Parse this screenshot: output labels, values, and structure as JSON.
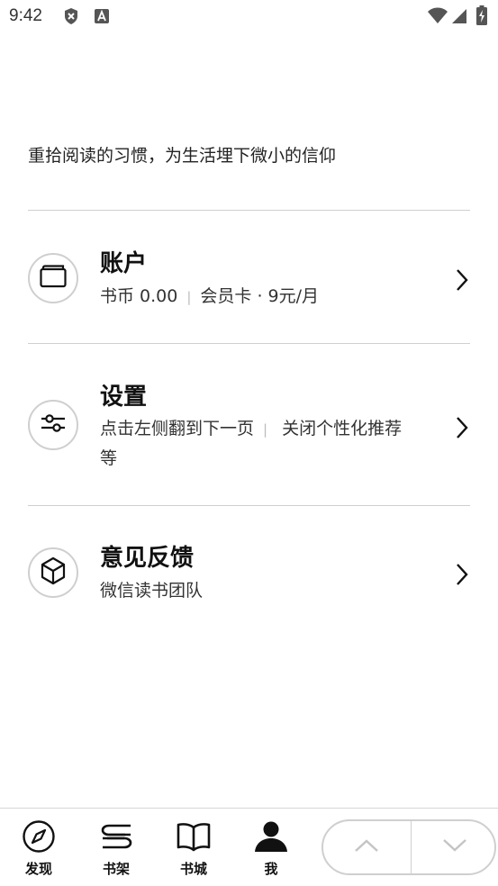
{
  "status_bar": {
    "time": "9:42"
  },
  "slogan": "重拾阅读的习惯，为生活埋下微小的信仰",
  "menu": {
    "account": {
      "title": "账户",
      "coins": "书币 0.00",
      "membership": "会员卡 · 9元/月",
      "icon": "wallet-icon"
    },
    "settings": {
      "title": "设置",
      "line1_part1": "点击左侧翻到下一页",
      "line1_part2": "关闭个性化推荐",
      "line2": "等",
      "icon": "sliders-icon"
    },
    "feedback": {
      "title": "意见反馈",
      "subtitle": "微信读书团队",
      "icon": "cube-icon"
    }
  },
  "bottom_nav": {
    "discover": "发现",
    "shelf": "书架",
    "store": "书城",
    "me": "我"
  },
  "colors": {
    "divider": "#cfcfcf",
    "text": "#111111"
  }
}
